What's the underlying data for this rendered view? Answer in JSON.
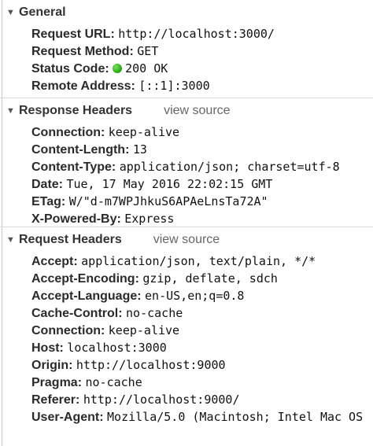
{
  "general": {
    "title": "General",
    "rows": [
      {
        "key": "Request URL:",
        "value": "http://localhost:3000/"
      },
      {
        "key": "Request Method:",
        "value": "GET"
      },
      {
        "key": "Status Code:",
        "value": "200 OK"
      },
      {
        "key": "Remote Address:",
        "value": "[::1]:3000"
      }
    ],
    "status_color": "#2fb21a"
  },
  "response_headers": {
    "title": "Response Headers",
    "view_source": "view source",
    "rows": [
      {
        "key": "Connection:",
        "value": "keep-alive"
      },
      {
        "key": "Content-Length:",
        "value": "13"
      },
      {
        "key": "Content-Type:",
        "value": "application/json; charset=utf-8"
      },
      {
        "key": "Date:",
        "value": "Tue, 17 May 2016 22:02:15 GMT"
      },
      {
        "key": "ETag:",
        "value": "W/\"d-m7WPJhkuS6APAeLnsTa72A\""
      },
      {
        "key": "X-Powered-By:",
        "value": "Express"
      }
    ]
  },
  "request_headers": {
    "title": "Request Headers",
    "view_source": "view source",
    "rows": [
      {
        "key": "Accept:",
        "value": "application/json, text/plain, */*"
      },
      {
        "key": "Accept-Encoding:",
        "value": "gzip, deflate, sdch"
      },
      {
        "key": "Accept-Language:",
        "value": "en-US,en;q=0.8"
      },
      {
        "key": "Cache-Control:",
        "value": "no-cache"
      },
      {
        "key": "Connection:",
        "value": "keep-alive"
      },
      {
        "key": "Host:",
        "value": "localhost:3000"
      },
      {
        "key": "Origin:",
        "value": "http://localhost:9000"
      },
      {
        "key": "Pragma:",
        "value": "no-cache"
      },
      {
        "key": "Referer:",
        "value": "http://localhost:9000/"
      },
      {
        "key": "User-Agent:",
        "value": "Mozilla/5.0 (Macintosh; Intel Mac OS"
      }
    ]
  },
  "icons": {
    "expanded": "▼"
  }
}
